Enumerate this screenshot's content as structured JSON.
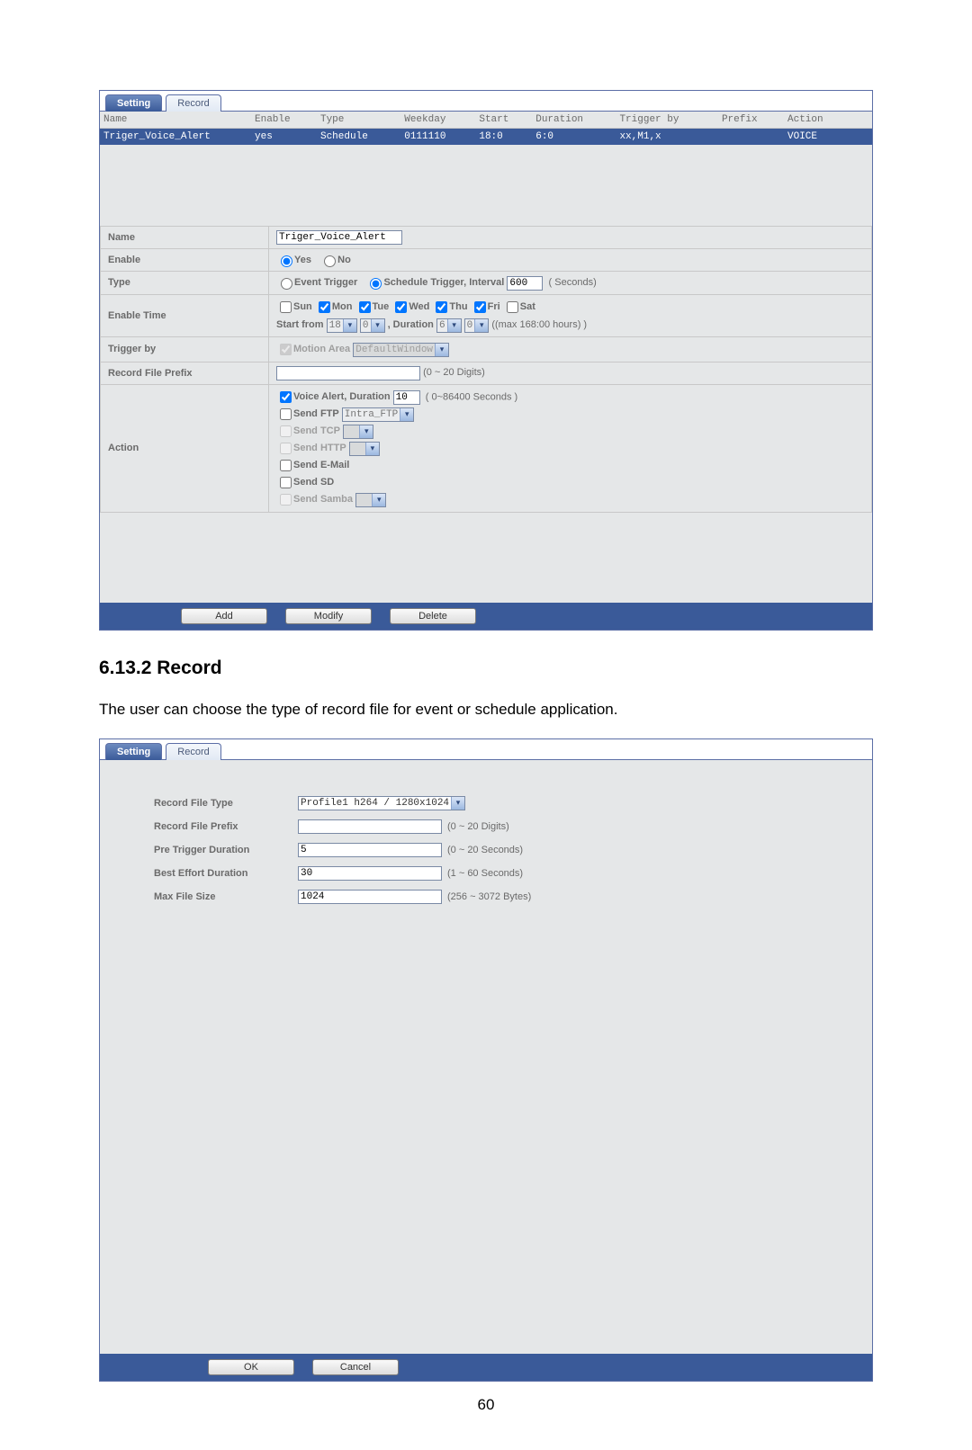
{
  "panel1": {
    "tabs": {
      "setting": "Setting",
      "record": "Record"
    },
    "cols": {
      "name": "Name",
      "enable": "Enable",
      "type": "Type",
      "weekday": "Weekday",
      "start": "Start",
      "duration": "Duration",
      "trigger_by": "Trigger by",
      "prefix": "Prefix",
      "action": "Action"
    },
    "row": {
      "name": "Triger_Voice_Alert",
      "enable": "yes",
      "type": "Schedule",
      "weekday": "0111110",
      "start": "18:0",
      "duration": "6:0",
      "trigger_by": "xx,M1,x",
      "prefix": "",
      "action": "VOICE"
    },
    "form": {
      "name_label": "Name",
      "name_value": "Triger_Voice_Alert",
      "enable_label": "Enable",
      "enable_yes": "Yes",
      "enable_no": "No",
      "type_label": "Type",
      "type_event": "Event Trigger",
      "type_schedule": "Schedule Trigger, Interval",
      "type_interval_value": "600",
      "type_interval_unit": "( Seconds)",
      "enable_time_label": "Enable Time",
      "days": {
        "sun": "Sun",
        "mon": "Mon",
        "tue": "Tue",
        "wed": "Wed",
        "thu": "Thu",
        "fri": "Fri",
        "sat": "Sat"
      },
      "start_from": "Start from",
      "start_h": "18",
      "start_m": "0",
      "duration_label": ", Duration",
      "dur_h": "6",
      "dur_m": "0",
      "max_hint": "((max 168:00 hours) )",
      "trigger_by_label": "Trigger by",
      "motion_area": "Motion Area",
      "motion_area_value": "DefaultWindow",
      "prefix_label": "Record File Prefix",
      "prefix_hint": "(0 ~ 20 Digits)",
      "action_label": "Action",
      "voice_alert": "Voice Alert, Duration",
      "voice_alert_value": "10",
      "voice_alert_hint": "( 0~86400 Seconds )",
      "send_ftp": "Send FTP",
      "send_ftp_value": "Intra_FTP",
      "send_tcp": "Send TCP",
      "send_http": "Send HTTP",
      "send_email": "Send E-Mail",
      "send_sd": "Send SD",
      "send_samba": "Send Samba"
    },
    "buttons": {
      "add": "Add",
      "modify": "Modify",
      "delete": "Delete"
    }
  },
  "section": {
    "heading": "6.13.2 Record",
    "text": "The user can choose the type of record file for event or schedule application."
  },
  "panel2": {
    "tabs": {
      "setting": "Setting",
      "record": "Record"
    },
    "fields": {
      "record_file_type": "Record File Type",
      "record_file_type_value": "Profile1 h264 / 1280x1024",
      "record_file_prefix": "Record File Prefix",
      "prefix_hint": "(0 ~ 20 Digits)",
      "pre_trigger": "Pre Trigger Duration",
      "pre_trigger_value": "5",
      "pre_trigger_hint": "(0 ~ 20 Seconds)",
      "best_effort": "Best Effort Duration",
      "best_effort_value": "30",
      "best_effort_hint": "(1 ~ 60 Seconds)",
      "max_file_size": "Max File Size",
      "max_file_size_value": "1024",
      "max_file_size_hint": "(256 ~ 3072 Bytes)"
    },
    "buttons": {
      "ok": "OK",
      "cancel": "Cancel"
    }
  },
  "page_number": "60"
}
